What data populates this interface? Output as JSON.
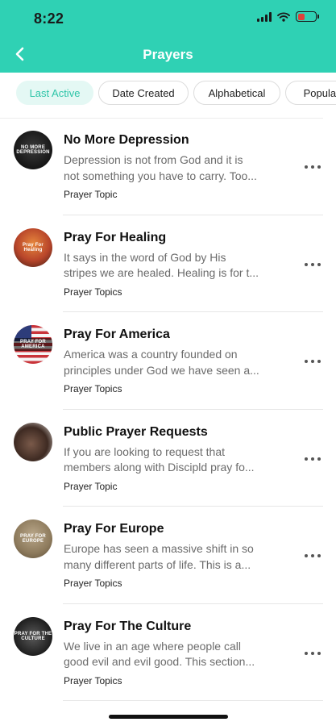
{
  "status_bar": {
    "time": "8:22"
  },
  "header": {
    "title": "Prayers"
  },
  "filters": [
    "Last Active",
    "Date Created",
    "Alphabetical",
    "Popular"
  ],
  "items": [
    {
      "title": "No More Depression",
      "desc_line1": "Depression is not from God and it is",
      "desc_line2": "not something you have to carry. Too...",
      "tag": "Prayer Topic",
      "avatar_text": "NO MORE DEPRESSION"
    },
    {
      "title": "Pray For Healing",
      "desc_line1": "It says in the word of God by His",
      "desc_line2": "stripes we are healed. Healing is for t...",
      "tag": "Prayer Topics",
      "avatar_text": "Pray For Healing"
    },
    {
      "title": "Pray For America",
      "desc_line1": "America was a country founded on",
      "desc_line2": "principles under God we have seen a...",
      "tag": "Prayer Topics",
      "avatar_text": "PRAY FOR AMERICA"
    },
    {
      "title": "Public Prayer Requests",
      "desc_line1": "If you are looking to request that",
      "desc_line2": "members along with Discipld pray fo...",
      "tag": "Prayer Topic",
      "avatar_text": ""
    },
    {
      "title": "Pray For Europe",
      "desc_line1": "Europe has seen a massive shift in so",
      "desc_line2": "many different parts of life. This is a...",
      "tag": "Prayer Topics",
      "avatar_text": "PRAY FOR EUROPE"
    },
    {
      "title": "Pray For The Culture",
      "desc_line1": "We live in an age where people call",
      "desc_line2": "good evil and evil good. This section...",
      "tag": "Prayer Topics",
      "avatar_text": "PRAY FOR THE CULTURE"
    }
  ],
  "colors": {
    "header": "#2fd1b4",
    "chip_active_bg": "#e4f8f4",
    "chip_active_text": "#2ec5a8",
    "battery": "#e0413a"
  },
  "icons": [
    "back-chevron-icon",
    "cellular-signal-icon",
    "wifi-icon",
    "battery-icon",
    "more-dots-icon"
  ]
}
